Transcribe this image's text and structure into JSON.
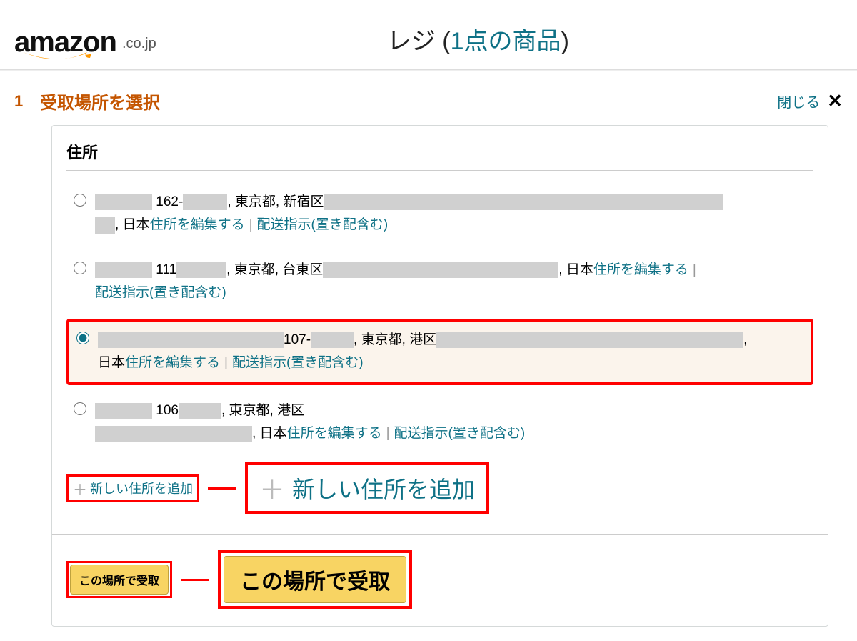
{
  "header": {
    "logo_text": "amazon",
    "logo_suffix": ".co.jp",
    "title_prefix": "レジ (",
    "title_count": "1点の商品",
    "title_suffix": ")"
  },
  "step": {
    "number": "1",
    "title": "受取場所を選択",
    "close_label": "閉じる",
    "close_glyph": "✕"
  },
  "panel": {
    "heading": "住所",
    "addresses": [
      {
        "selected": false,
        "zip_prefix": "162-",
        "region": ", 東京都, 新宿区",
        "country": ", 日本 ",
        "edit_label": "住所を編集する",
        "delivery_label": "配送指示(置き配含む)"
      },
      {
        "selected": false,
        "zip_prefix": "111",
        "region": ", 東京都, 台東区",
        "country": ", 日本 ",
        "edit_label": "住所を編集する",
        "delivery_label": "配送指示(置き配含む)"
      },
      {
        "selected": true,
        "zip_sep": " 107-",
        "region": ", 東京都, 港区",
        "country": "日本 ",
        "edit_label": "住所を編集する",
        "delivery_label": "配送指示(置き配含む)"
      },
      {
        "selected": false,
        "zip_prefix": "106",
        "region": ", 東京都, 港区",
        "country": ", 日本 ",
        "edit_label": "住所を編集する",
        "delivery_label": "配送指示(置き配含む)"
      }
    ],
    "add_new_label": "新しい住所を追加",
    "plus_glyph": "＋",
    "confirm_label": "この場所で受取",
    "separator": "|"
  }
}
